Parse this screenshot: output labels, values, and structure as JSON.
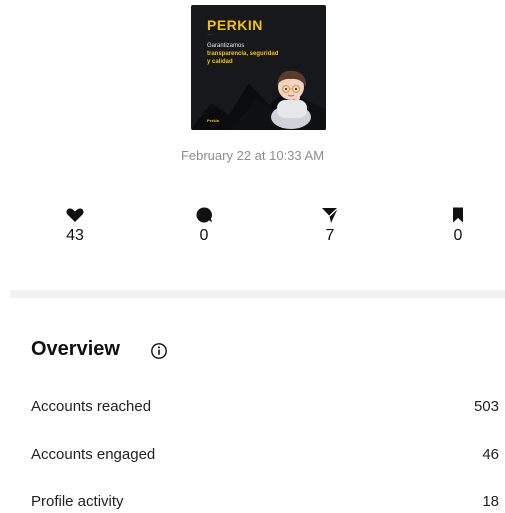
{
  "post_thumbnail": {
    "brand": "PERKIN",
    "brand_sub": "......",
    "lines": [
      "Garantizamos",
      "transparencia, seguridad",
      "y calidad"
    ],
    "footer_logo": "Perkin",
    "accent_color": "#f5c400",
    "background_color": "#16181c"
  },
  "timestamp": "February 22 at 10:33 AM",
  "stats": {
    "likes": {
      "icon": "heart-icon",
      "value": "43"
    },
    "comments": {
      "icon": "comment-icon",
      "value": "0"
    },
    "shares": {
      "icon": "share-icon",
      "value": "7"
    },
    "saves": {
      "icon": "bookmark-icon",
      "value": "0"
    }
  },
  "overview": {
    "title": "Overview",
    "rows": [
      {
        "label": "Accounts reached",
        "value": "503"
      },
      {
        "label": "Accounts engaged",
        "value": "46"
      },
      {
        "label": "Profile activity",
        "value": "18"
      }
    ]
  }
}
